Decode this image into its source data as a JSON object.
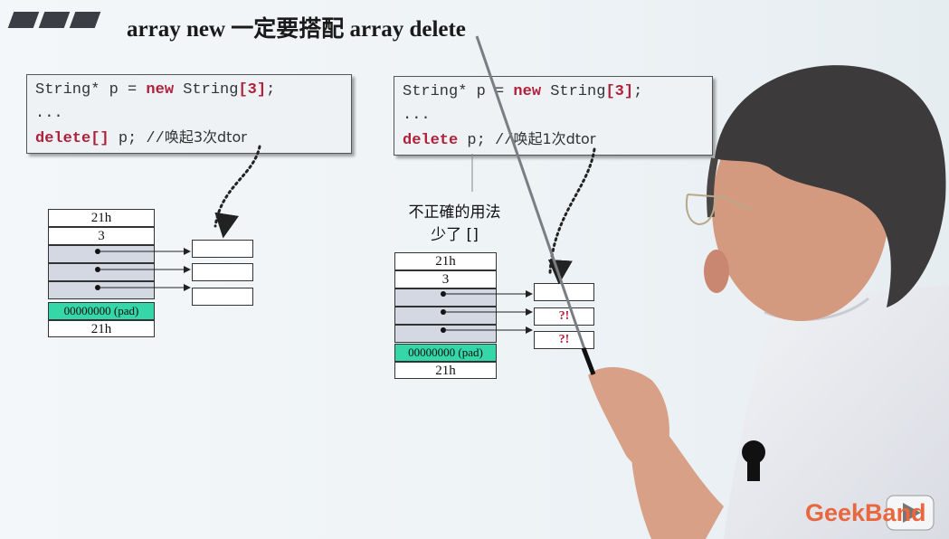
{
  "slide": {
    "title": "array new 一定要搭配 array delete"
  },
  "left_code": {
    "line1_a": "String* p = ",
    "line1_kw": "new",
    "line1_b": " String",
    "line1_c": "[3]",
    "line1_d": ";",
    "line2": "...",
    "line3_kw": "delete[]",
    "line3_b": " p; //",
    "line3_zh": "唤起3次dtor"
  },
  "right_code": {
    "line1_a": "String* p = ",
    "line1_kw": "new",
    "line1_b": " String",
    "line1_c": "[3]",
    "line1_d": ";",
    "line2": "...",
    "line3_kw": "delete",
    "line3_b": " p; //",
    "line3_zh": "唤起1次dtor"
  },
  "left_memory": {
    "rows": [
      "21h",
      "3",
      "",
      "",
      "",
      "00000000 (pad)",
      "21h"
    ]
  },
  "right_memory": {
    "rows": [
      "21h",
      "3",
      "",
      "",
      "",
      "00000000 (pad)",
      "21h"
    ],
    "targets": [
      "",
      "?!",
      "?!"
    ]
  },
  "note": {
    "line1": "不正確的用法",
    "line2": "少了 []"
  },
  "brand": {
    "logo": "GeekBand"
  },
  "colors": {
    "keyword": "#b0203a",
    "pad": "#35d6a7",
    "pointer_cell": "#d3d8e2",
    "logo": "#e8673e"
  }
}
